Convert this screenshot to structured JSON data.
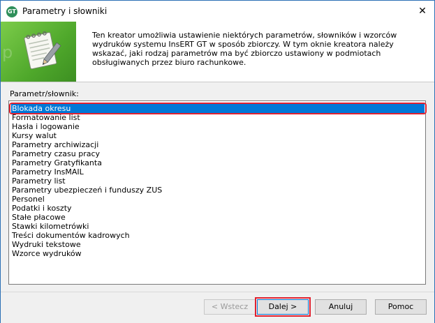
{
  "window": {
    "title": "Parametry i słowniki",
    "app_icon_text": "GT",
    "close_glyph": "✕",
    "app_icon": "insert-gt-icon",
    "close_icon": "close-icon"
  },
  "header": {
    "description": "Ten kreator umożliwia ustawienie niektórych parametrów, słowników i wzorców wydruków systemu InsERT GT w sposób zbiorczy. W tym oknie kreatora należy wskazać, jaki rodzaj parametrów ma być zbiorczo ustawiony w podmiotach obsługiwanych przez biuro rachunkowe.",
    "banner_watermark": "p",
    "banner_icon": "notepad-pencil-icon",
    "banner_color": "#4fa82b"
  },
  "list": {
    "label": "Parametr/słownik:",
    "selected_index": 0,
    "items": [
      "Blokada okresu",
      "Formatowanie list",
      "Hasła i logowanie",
      "Kursy walut",
      "Parametry archiwizacji",
      "Parametry czasu pracy",
      "Parametry Gratyfikanta",
      "Parametry InsMAIL",
      "Parametry list",
      "Parametry ubezpieczeń i funduszy ZUS",
      "Personel",
      "Podatki i koszty",
      "Stałe płacowe",
      "Stawki kilometrówki",
      "Treści dokumentów kadrowych",
      "Wydruki tekstowe",
      "Wzorce wydruków"
    ]
  },
  "buttons": {
    "back": "< Wstecz",
    "next": "Dalej >",
    "cancel": "Anuluj",
    "help": "Pomoc"
  },
  "colors": {
    "selection": "#0078d7",
    "highlight": "#e0212f"
  }
}
